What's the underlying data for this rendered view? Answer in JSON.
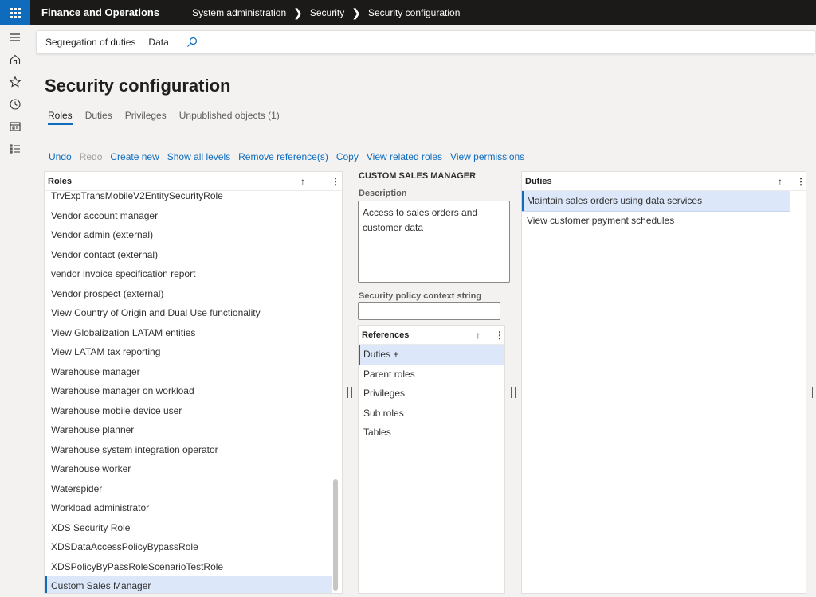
{
  "app": {
    "name": "Finance and Operations"
  },
  "breadcrumb": [
    "System administration",
    "Security",
    "Security configuration"
  ],
  "action_pane": {
    "items": [
      "Segregation of duties",
      "Data"
    ],
    "search_icon": "search-icon"
  },
  "page": {
    "title": "Security configuration"
  },
  "tabs": [
    {
      "label": "Roles",
      "active": true
    },
    {
      "label": "Duties",
      "active": false
    },
    {
      "label": "Privileges",
      "active": false
    },
    {
      "label": "Unpublished objects (1)",
      "active": false
    }
  ],
  "toolbar": [
    {
      "label": "Undo",
      "enabled": true
    },
    {
      "label": "Redo",
      "enabled": false
    },
    {
      "label": "Create new",
      "enabled": true
    },
    {
      "label": "Show all levels",
      "enabled": true
    },
    {
      "label": "Remove reference(s)",
      "enabled": true
    },
    {
      "label": "Copy",
      "enabled": true
    },
    {
      "label": "View related roles",
      "enabled": true
    },
    {
      "label": "View permissions",
      "enabled": true
    }
  ],
  "roles": {
    "header": "Roles",
    "items": [
      "TrvExpTransMobileV2EntitySecurityRole",
      "Vendor account manager",
      "Vendor admin (external)",
      "Vendor contact (external)",
      "vendor invoice specification report",
      "Vendor prospect (external)",
      "View Country of Origin and Dual Use functionality",
      "View Globalization LATAM entities",
      "View LATAM tax reporting",
      "Warehouse manager",
      "Warehouse manager on workload",
      "Warehouse mobile device user",
      "Warehouse planner",
      "Warehouse system integration operator",
      "Warehouse worker",
      "Waterspider",
      "Workload administrator",
      "XDS Security Role",
      "XDSDataAccessPolicyBypassRole",
      "XDSPolicyByPassRoleScenarioTestRole",
      "Custom Sales Manager"
    ],
    "selected": "Custom Sales Manager"
  },
  "detail": {
    "title": "CUSTOM SALES MANAGER",
    "description_label": "Description",
    "description": "Access to sales orders and customer data",
    "context_label": "Security policy context string",
    "context_value": ""
  },
  "references": {
    "header": "References",
    "items": [
      "Duties +",
      "Parent roles",
      "Privileges",
      "Sub roles",
      "Tables"
    ],
    "selected": "Duties +"
  },
  "duties": {
    "header": "Duties",
    "items": [
      "Maintain sales orders using data services",
      "View customer payment schedules"
    ],
    "selected": "Maintain sales orders using data services"
  },
  "glyphs": {
    "sort": "↑",
    "more": "⋮",
    "chevron": "›"
  }
}
